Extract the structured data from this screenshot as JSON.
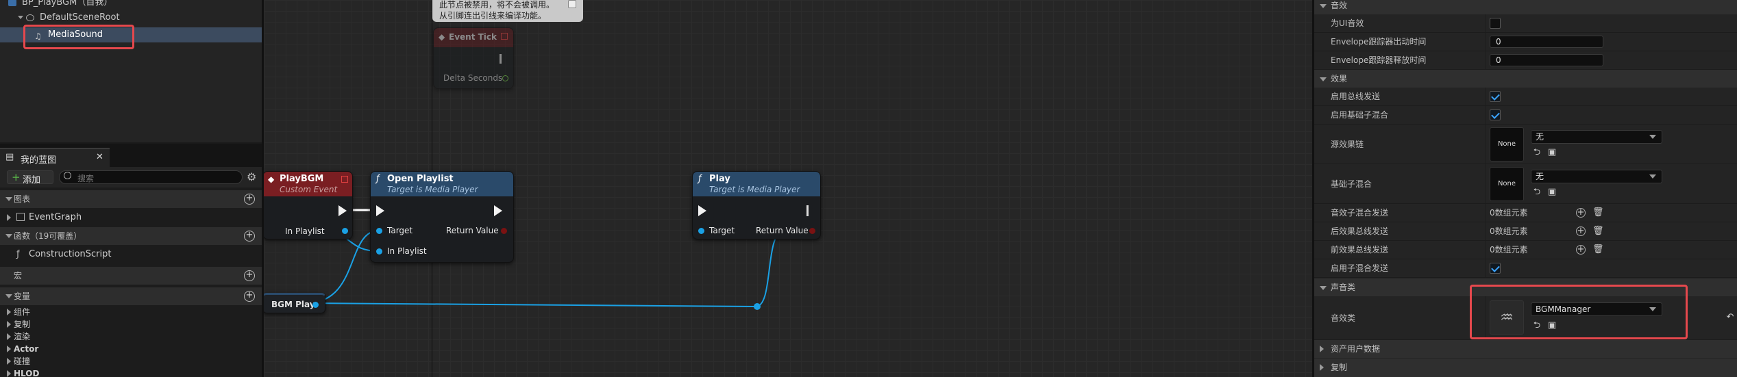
{
  "outliner": {
    "root_label": "BP_PlayBGM（自我）",
    "scene_root_label": "DefaultSceneRoot",
    "selected_item_label": "MediaSound"
  },
  "my_blueprint": {
    "tab_label": "我的蓝图",
    "add_button_label": "添加",
    "search_placeholder": "搜索",
    "sections": {
      "graphs": "图表",
      "functions": "函数（19可覆盖）",
      "macros": "宏",
      "variables": "变量"
    },
    "graph_items": [
      "EventGraph"
    ],
    "function_items": [
      "ConstructionScript"
    ],
    "variable_categories": [
      "组件",
      "复制",
      "渲染",
      "Actor",
      "碰撞",
      "HLOD"
    ]
  },
  "graph": {
    "comment_line1": "此节点被禁用，将不会被调用。",
    "comment_line2": "从引脚连出引线来编译功能。",
    "event_tick": {
      "title": "Event Tick",
      "pin": "Delta Seconds"
    },
    "playbgm": {
      "title": "PlayBGM",
      "subtitle": "Custom Event",
      "pin": "In Playlist"
    },
    "open_playlist": {
      "title": "Open Playlist",
      "subtitle": "Target is Media Player",
      "pin_target": "Target",
      "pin_playlist": "In Playlist",
      "pin_return": "Return Value"
    },
    "play": {
      "title": "Play",
      "subtitle": "Target is Media Player",
      "pin_target": "Target",
      "pin_return": "Return Value"
    },
    "var_node": {
      "title": "BGM Play"
    },
    "colors": {
      "event_header": "#7a1e22",
      "function_header": "#2a4a6a",
      "wire_data": "#1aa1e5",
      "wire_exec": "#ffffff"
    }
  },
  "details": {
    "sections": {
      "sound": "音效",
      "effects": "效果",
      "sound_class": "声音类",
      "asset_user_data": "资产用户数据",
      "replication": "复制"
    },
    "rows": {
      "ui_sound": "为UI音效",
      "env_follower_attack": "Envelope跟踪器出动时间",
      "env_follower_attack_value": "0",
      "env_follower_release": "Envelope跟踪器释放时间",
      "env_follower_release_value": "0",
      "enable_bus_sends": "启用总线发送",
      "enable_base_submix": "启用基础子混合",
      "source_effect_chain": "源效果链",
      "source_effect_value": "无",
      "base_submix": "基础子混合",
      "base_submix_value": "无",
      "submix_sends": "音效子混合发送",
      "post_effect_bus_sends": "后效果总线发送",
      "pre_effect_bus_sends": "前效果总线发送",
      "enable_submix_sends": "启用子混合发送",
      "array_elements": "0数组元素",
      "sound_class_label": "音效类",
      "sound_class_value": "BGMManager",
      "none_thumb": "None"
    }
  }
}
